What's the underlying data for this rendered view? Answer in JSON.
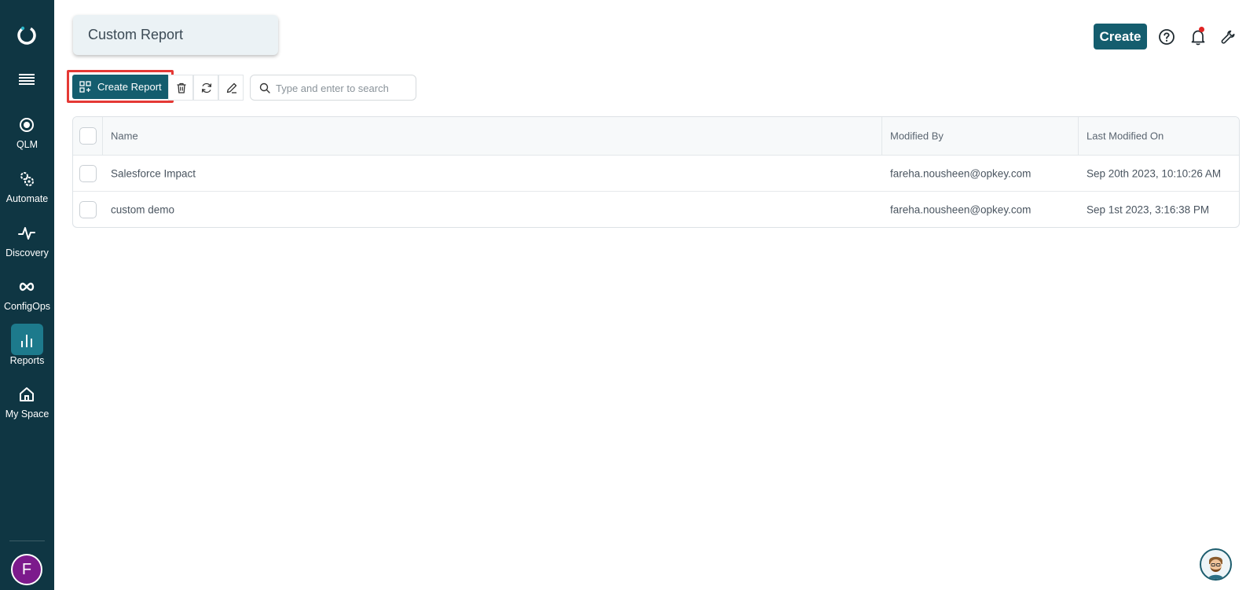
{
  "sidebar": {
    "items": [
      {
        "label": "QLM",
        "icon": "target-icon"
      },
      {
        "label": "Automate",
        "icon": "gears-icon"
      },
      {
        "label": "Discovery",
        "icon": "pulse-icon"
      },
      {
        "label": "ConfigOps",
        "icon": "infinity-icon"
      },
      {
        "label": "Reports",
        "icon": "bar-chart-icon",
        "active": true
      },
      {
        "label": "My Space",
        "icon": "home-icon"
      }
    ],
    "avatar_initial": "F",
    "avatar_color": "#7c1a8c"
  },
  "header": {
    "title": "Custom Report",
    "create_label": "Create"
  },
  "toolbar": {
    "create_report_label": "Create Report",
    "search_placeholder": "Type and enter to search"
  },
  "table": {
    "columns": [
      "Name",
      "Modified By",
      "Last Modified On"
    ],
    "rows": [
      {
        "name": "Salesforce Impact",
        "modified_by": "fareha.nousheen@opkey.com",
        "last_modified_on": "Sep 20th 2023, 10:10:26 AM"
      },
      {
        "name": "custom demo",
        "modified_by": "fareha.nousheen@opkey.com",
        "last_modified_on": "Sep 1st 2023, 3:16:38 PM"
      }
    ]
  },
  "colors": {
    "sidebar_bg": "#0f3643",
    "primary": "#145d6e",
    "active_nav": "#1d7a8c",
    "highlight": "#e53935",
    "notification_dot": "#e02424"
  }
}
